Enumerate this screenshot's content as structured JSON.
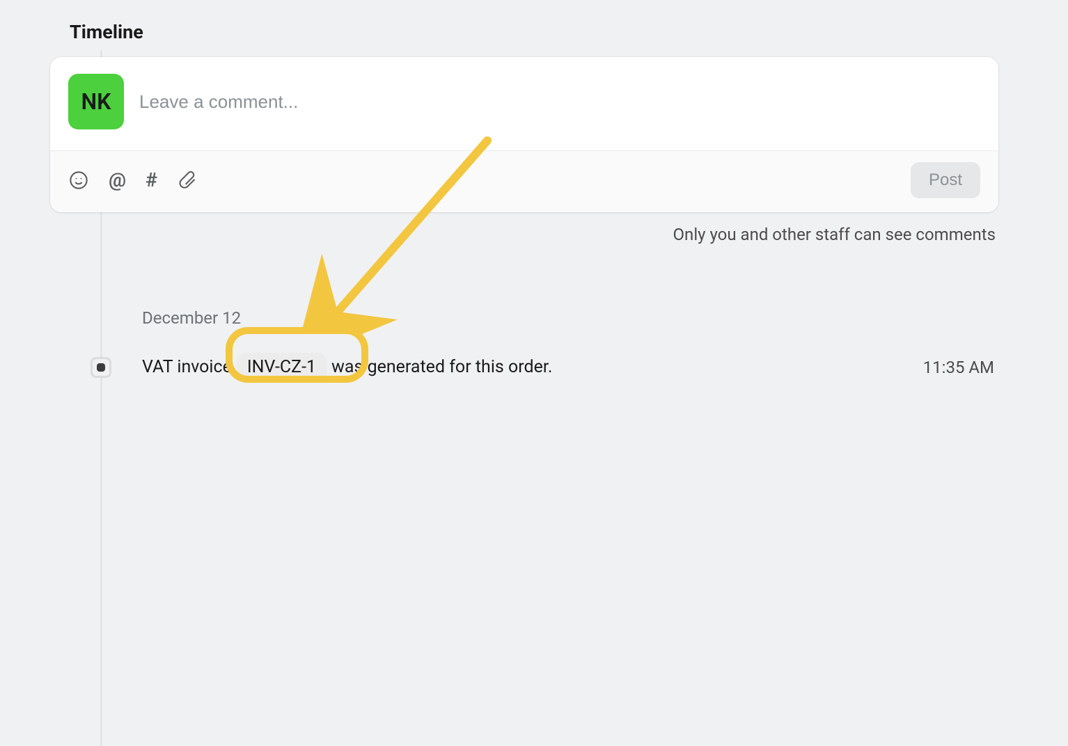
{
  "section_title": "Timeline",
  "avatar_initials": "NK",
  "comment": {
    "placeholder": "Leave a comment...",
    "post_label": "Post",
    "icons": {
      "emoji": "emoji-icon",
      "mention": "@",
      "hashtag": "#",
      "attach": "attach-icon"
    }
  },
  "visibility_note": "Only you and other staff can see comments",
  "timeline": {
    "date_label": "December 12",
    "entry": {
      "text_before": "VAT invoice",
      "badge": "INV-CZ-1",
      "text_after": "was generated for this order.",
      "time": "11:35 AM"
    }
  }
}
